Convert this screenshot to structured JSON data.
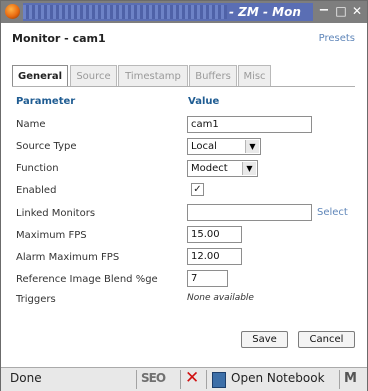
{
  "window": {
    "title": "- ZM - Mon",
    "buttons": [
      "−",
      "□",
      "✕"
    ]
  },
  "header": {
    "title": "Monitor - cam1",
    "presets_link": "Presets"
  },
  "tabs": [
    {
      "label": "General",
      "active": true
    },
    {
      "label": "Source",
      "active": false
    },
    {
      "label": "Timestamp",
      "active": false
    },
    {
      "label": "Buffers",
      "active": false
    },
    {
      "label": "Misc",
      "active": false
    }
  ],
  "form": {
    "col_parameter": "Parameter",
    "col_value": "Value",
    "name": {
      "label": "Name",
      "value": "cam1"
    },
    "source_type": {
      "label": "Source Type",
      "value": "Local"
    },
    "function": {
      "label": "Function",
      "value": "Modect"
    },
    "enabled": {
      "label": "Enabled",
      "checked": true,
      "mark": "✓"
    },
    "linked_monitors": {
      "label": "Linked Monitors",
      "value": "",
      "link": "Select"
    },
    "max_fps": {
      "label": "Maximum FPS",
      "value": "15.00"
    },
    "alarm_max_fps": {
      "label": "Alarm Maximum FPS",
      "value": "12.00"
    },
    "ref_blend": {
      "label": "Reference Image Blend %ge",
      "value": "7"
    },
    "triggers": {
      "label": "Triggers",
      "value": "None available"
    }
  },
  "actions": {
    "save": "Save",
    "cancel": "Cancel"
  },
  "statusbar": {
    "status": "Done",
    "seo": "SEO",
    "notebook": "Open Notebook",
    "m_icon": "M"
  },
  "colors": {
    "accent": "#1f5c92",
    "link": "#5f86b9",
    "titlebar": "#5a6eb4"
  }
}
